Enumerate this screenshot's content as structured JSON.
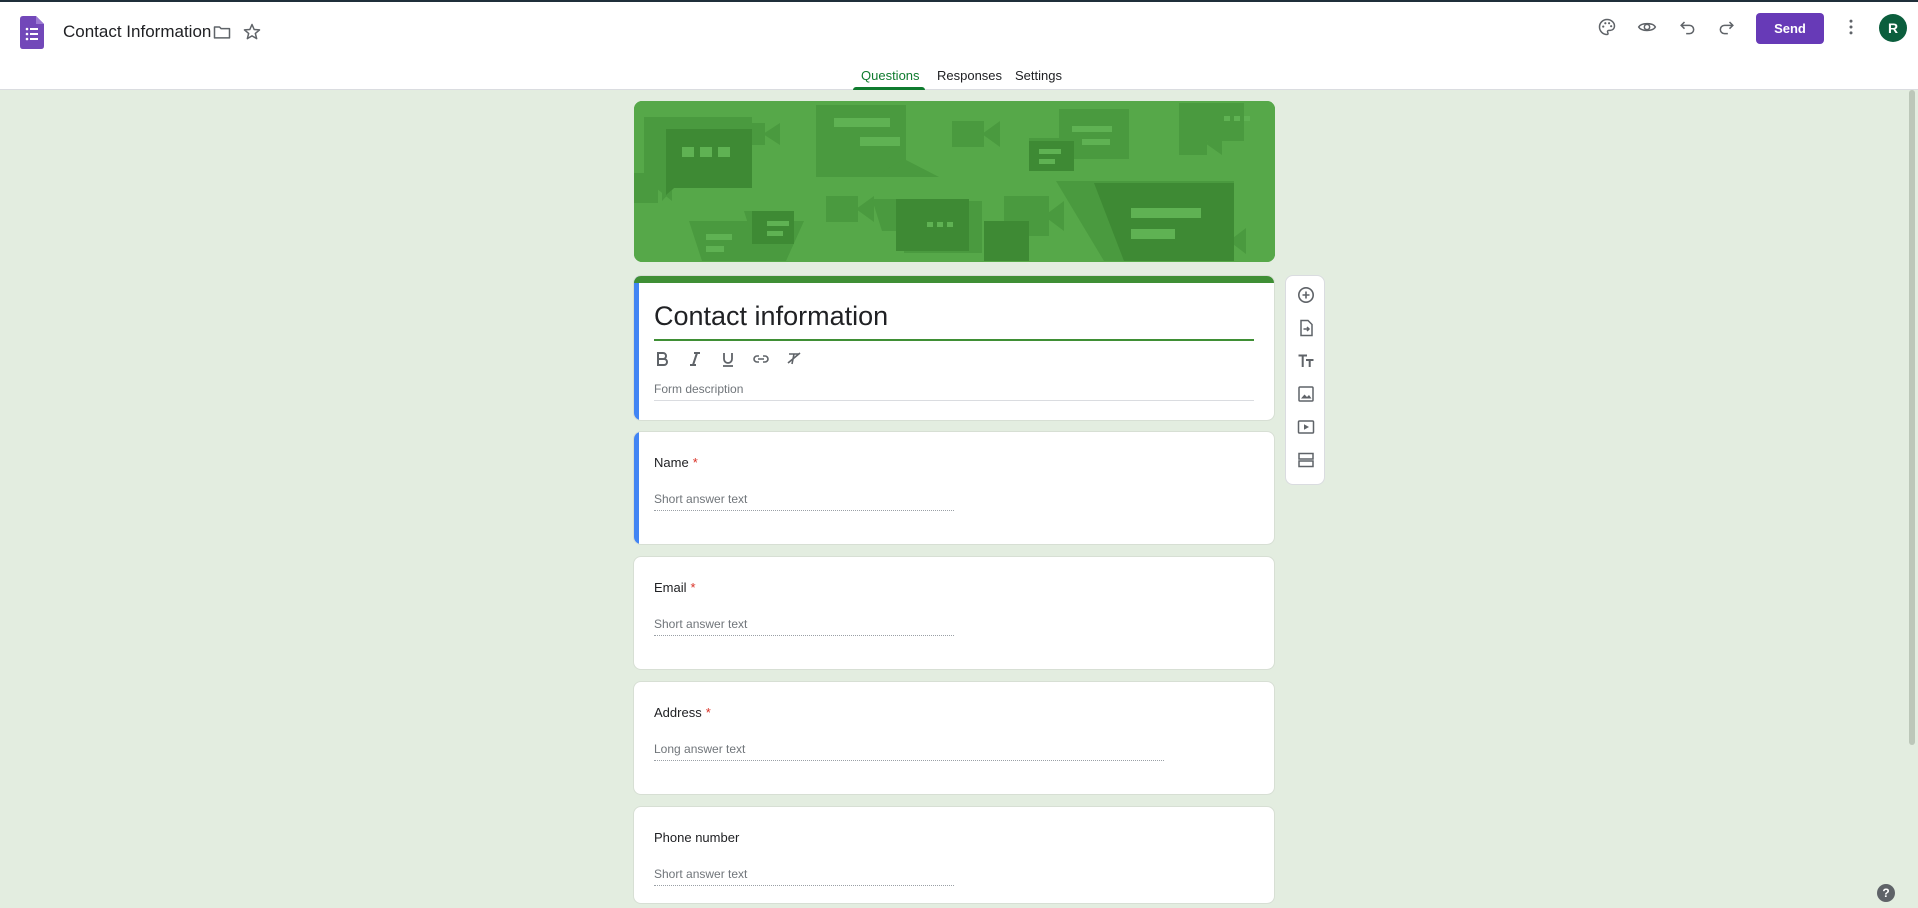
{
  "header": {
    "doc_title": "Contact Information",
    "send_label": "Send",
    "avatar_initial": "R",
    "icons": [
      "forms-logo-icon",
      "folder-icon",
      "star-icon",
      "palette-icon",
      "eye-icon",
      "undo-icon",
      "redo-icon",
      "more-vert-icon"
    ]
  },
  "tabs": {
    "questions": "Questions",
    "responses": "Responses",
    "settings": "Settings",
    "active": "Questions"
  },
  "form": {
    "title": "Contact information",
    "description_placeholder": "Form description",
    "format_icons": [
      "bold-icon",
      "italic-icon",
      "underline-icon",
      "link-icon",
      "clear-format-icon"
    ]
  },
  "questions": [
    {
      "label": "Name",
      "required_mark": "*",
      "placeholder": "Short answer text"
    },
    {
      "label": "Email",
      "required_mark": "*",
      "placeholder": "Short answer text"
    },
    {
      "label": "Address",
      "required_mark": "*",
      "placeholder": "Long answer text"
    },
    {
      "label": "Phone number",
      "required_mark": "",
      "placeholder": "Short answer text"
    }
  ],
  "side_toolbar": [
    "add-question-icon",
    "import-questions-icon",
    "add-title-icon",
    "add-image-icon",
    "add-video-icon",
    "add-section-icon"
  ],
  "help_label": "?",
  "colors": {
    "accent": "#673ab7",
    "theme_green": "#3f8f35",
    "background": "#e3ede0",
    "selection_blue": "#4285f4",
    "required_red": "#d93025"
  }
}
